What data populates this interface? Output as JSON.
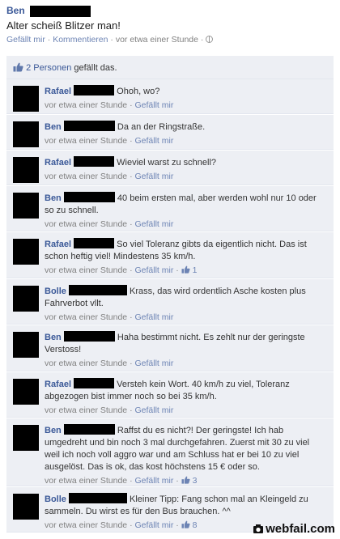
{
  "post": {
    "author": "Ben",
    "text": "Alter scheiß Blitzer man!",
    "like_label": "Gefällt mir",
    "comment_label": "Kommentieren",
    "time": "vor etwa einer Stunde",
    "sep": "·"
  },
  "likes": {
    "count_label": "2 Personen",
    "suffix": "gefällt das."
  },
  "comments": [
    {
      "author": "Rafael",
      "text": "Ohoh, wo?",
      "time": "vor etwa einer Stunde",
      "like_label": "Gefällt mir",
      "likes": ""
    },
    {
      "author": "Ben",
      "text": "Da an der Ringstraße.",
      "time": "vor etwa einer Stunde",
      "like_label": "Gefällt mir",
      "likes": ""
    },
    {
      "author": "Rafael",
      "text": "Wieviel warst zu schnell?",
      "time": "vor etwa einer Stunde",
      "like_label": "Gefällt mir",
      "likes": ""
    },
    {
      "author": "Ben",
      "text": "40 beim ersten mal, aber werden wohl nur 10 oder so zu schnell.",
      "time": "vor etwa einer Stunde",
      "like_label": "Gefällt mir",
      "likes": ""
    },
    {
      "author": "Rafael",
      "text": "So viel Toleranz gibts da eigentlich nicht. Das ist schon heftig viel! Mindestens 35 km/h.",
      "time": "vor etwa einer Stunde",
      "like_label": "Gefällt mir",
      "likes": "1"
    },
    {
      "author": "Bolle",
      "text": "Krass, das wird ordentlich Asche kosten plus Fahrverbot vllt.",
      "time": "vor etwa einer Stunde",
      "like_label": "Gefällt mir",
      "likes": ""
    },
    {
      "author": "Ben",
      "text": "Haha bestimmt nicht. Es zehlt nur der geringste Verstoss!",
      "time": "vor etwa einer Stunde",
      "like_label": "Gefällt mir",
      "likes": ""
    },
    {
      "author": "Rafael",
      "text": "Versteh kein Wort. 40 km/h zu viel, Toleranz abgezogen bist immer noch so bei 35 km/h.",
      "time": "vor etwa einer Stunde",
      "like_label": "Gefällt mir",
      "likes": ""
    },
    {
      "author": "Ben",
      "text": "Raffst du es nicht?! Der geringste! Ich hab umgedreht und bin noch 3 mal durchgefahren. Zuerst mit 30 zu viel weil ich noch voll aggro war und am Schluss hat er bei 10 zu viel ausgelöst. Das is ok, das kost höchstens 15 € oder so.",
      "time": "vor etwa einer Stunde",
      "like_label": "Gefällt mir",
      "likes": "3"
    },
    {
      "author": "Bolle",
      "text": "Kleiner Tipp: Fang schon mal an Kleingeld zu sammeln. Du wirst es für den Bus brauchen. ^^",
      "time": "vor etwa einer Stunde",
      "like_label": "Gefällt mir",
      "likes": "8"
    }
  ],
  "watermark": {
    "text": "webfail.com"
  },
  "colors": {
    "link": "#3b5998",
    "comment_bg": "#edeff4",
    "meta": "#808080"
  },
  "icons": {
    "globe": "globe-icon",
    "like": "thumbs-up-icon",
    "watermark": "camera-icon"
  }
}
